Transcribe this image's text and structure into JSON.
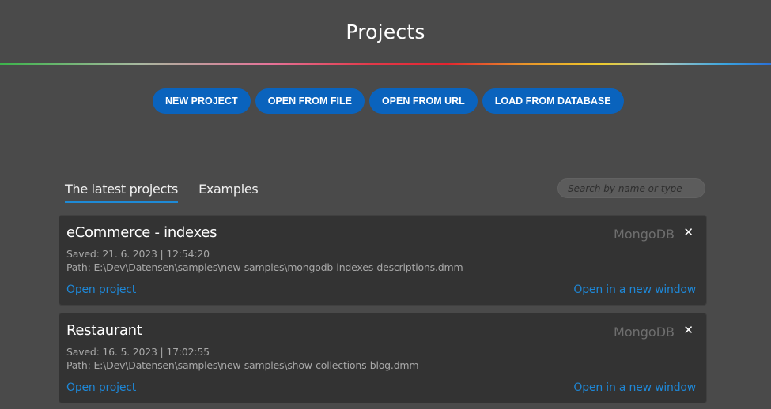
{
  "header": {
    "title": "Projects"
  },
  "actions": {
    "new_project": "NEW PROJECT",
    "open_from_file": "OPEN FROM FILE",
    "open_from_url": "OPEN FROM URL",
    "load_from_database": "LOAD FROM DATABASE"
  },
  "tabs": [
    {
      "label": "The latest projects",
      "active": true
    },
    {
      "label": "Examples",
      "active": false
    }
  ],
  "search": {
    "placeholder": "Search by name or type",
    "value": ""
  },
  "projects": [
    {
      "name": "eCommerce - indexes",
      "type": "MongoDB",
      "saved": "Saved: 21. 6. 2023 | 12:54:20",
      "path": "Path: E:\\Dev\\Datensen\\samples\\new-samples\\mongodb-indexes-descriptions.dmm",
      "open_label": "Open project",
      "open_new_window_label": "Open in a new window",
      "close_glyph": "✕"
    },
    {
      "name": "Restaurant",
      "type": "MongoDB",
      "saved": "Saved: 16. 5. 2023 | 17:02:55",
      "path": "Path: E:\\Dev\\Datensen\\samples\\new-samples\\show-collections-blog.dmm",
      "open_label": "Open project",
      "open_new_window_label": "Open in a new window",
      "close_glyph": "✕"
    }
  ],
  "colors": {
    "background": "#4a4a4a",
    "card_background": "#333333",
    "button": "#0a63bd",
    "link": "#1e88d8",
    "tab_underline": "#1e8ad6"
  }
}
